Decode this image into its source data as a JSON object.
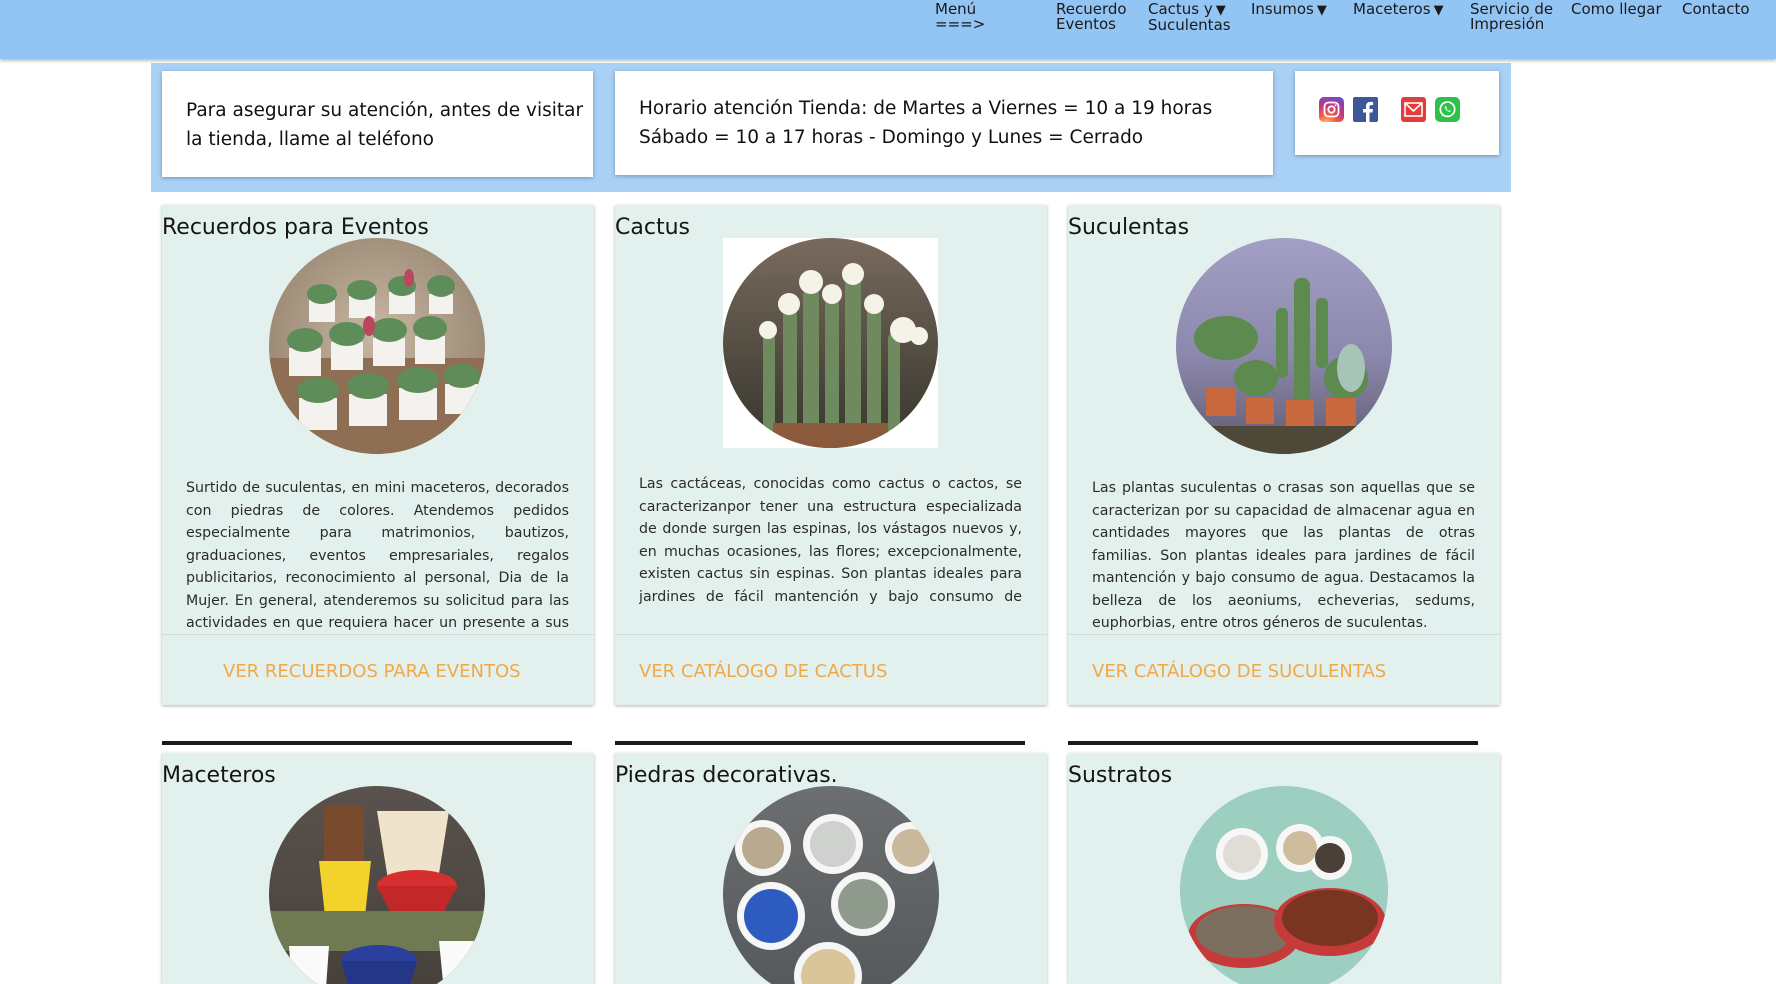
{
  "nav": {
    "menu": {
      "line1": "Menú",
      "line2": "===>"
    },
    "recuerdo_eventos": {
      "line1": "Recuerdo",
      "line2": "Eventos"
    },
    "cactus_suculentas": {
      "line1": "Cactus y",
      "line2": "Suculentas"
    },
    "insumos": "Insumos",
    "maceteros": "Maceteros",
    "servicio_impresion": {
      "line1": "Servicio de",
      "line2": "Impresión"
    },
    "como_llegar": "Como llegar",
    "contacto": "Contacto",
    "caret": "▼"
  },
  "info": {
    "phone_text": {
      "line1": "Para asegurar su atención, antes de visitar",
      "line2": "la tienda, llame al teléfono"
    },
    "hours": {
      "line1": "Horario atención Tienda:  de Martes a Viernes = 10 a 19 horas",
      "line2": "Sábado = 10 a 17 horas - Domingo y Lunes = Cerrado"
    },
    "social_icons": [
      "instagram-icon",
      "facebook-icon",
      "email-icon",
      "whatsapp-icon"
    ]
  },
  "cards": [
    {
      "title": "Recuerdos para Eventos",
      "description": "Surtido de suculentas, en mini maceteros, decorados con piedras de colores. Atendemos pedidos especialmente para matrimonios, bautizos, graduaciones, eventos empresariales, regalos publicitarios, reconocimiento al personal, Dia de la Mujer. En general, atenderemos su solicitud para las actividades en que requiera hacer un presente a sus invitados, cualquiera sea la cantidad de",
      "link": "VER RECUERDOS PARA EVENTOS"
    },
    {
      "title": "Cactus",
      "description": "Las cactáceas, conocidas como cactus o cactos, se caracterizanpor tener una estructura especializada de donde surgen las espinas, los vástagos nuevos y, en muchas ocasiones, las flores; excepcionalmente, existen cactus sin espinas. Son plantas ideales para jardines de fácil mantención y bajo consumo de agua.",
      "link": "VER CATÁLOGO DE CACTUS"
    },
    {
      "title": "Suculentas",
      "description": "Las plantas suculentas o crasas son aquellas que se caracterizan por su capacidad de almacenar agua en cantidades mayores que las plantas de otras familias. Son plantas ideales para jardines de fácil mantención y bajo consumo de agua. Destacamos la belleza de los aeoniums, echeverias, sedums, euphorbias, entre otros géneros de suculentas.",
      "link": "VER CATÁLOGO DE SUCULENTAS"
    },
    {
      "title": "Maceteros"
    },
    {
      "title": "Piedras decorativas."
    },
    {
      "title": "Sustratos"
    }
  ],
  "colors": {
    "nav_bg": "#93c5f4",
    "band_bg": "#a9d0f5",
    "card_bg": "#e3f1ee",
    "link": "#f0a848"
  }
}
